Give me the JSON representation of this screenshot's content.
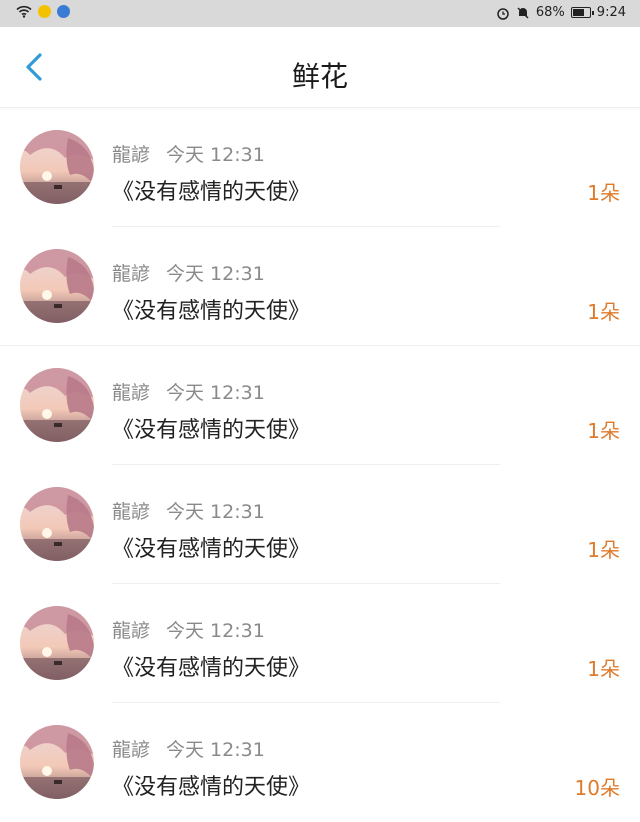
{
  "status_bar": {
    "battery_pct": "68%",
    "time": "9:24"
  },
  "header": {
    "title": "鲜花"
  },
  "items": [
    {
      "name": "龍諺",
      "time": "今天 12:31",
      "message": "《没有感情的天使》",
      "count": "1朵"
    },
    {
      "name": "龍諺",
      "time": "今天 12:31",
      "message": "《没有感情的天使》",
      "count": "1朵"
    },
    {
      "name": "龍諺",
      "time": "今天 12:31",
      "message": "《没有感情的天使》",
      "count": "1朵"
    },
    {
      "name": "龍諺",
      "time": "今天 12:31",
      "message": "《没有感情的天使》",
      "count": "1朵"
    },
    {
      "name": "龍諺",
      "time": "今天 12:31",
      "message": "《没有感情的天使》",
      "count": "1朵"
    },
    {
      "name": "龍諺",
      "time": "今天 12:31",
      "message": "《没有感情的天使》",
      "count": "10朵"
    }
  ],
  "colors": {
    "accent": "#2f9bd9",
    "count": "#e07a2b"
  }
}
